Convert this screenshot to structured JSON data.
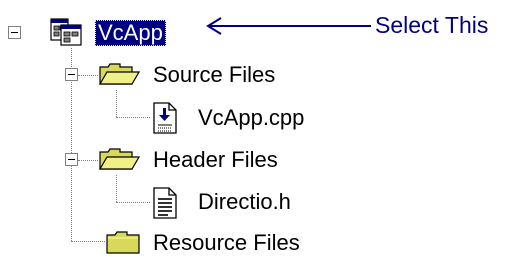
{
  "tree": {
    "root": {
      "label": "VcApp",
      "icon": "workspace-icon",
      "expander": "minus",
      "children": [
        {
          "label": "Source Files",
          "icon": "folder-open-icon",
          "expander": "minus",
          "children": [
            {
              "label": "VcApp.cpp",
              "icon": "source-file-icon"
            }
          ]
        },
        {
          "label": "Header Files",
          "icon": "folder-open-icon",
          "expander": "minus",
          "children": [
            {
              "label": "Directio.h",
              "icon": "header-file-icon"
            }
          ]
        },
        {
          "label": "Resource Files",
          "icon": "folder-closed-icon"
        }
      ]
    }
  },
  "annotation": {
    "text": "Select This",
    "color": "#000080"
  },
  "colors": {
    "selection_background": "#000080",
    "selection_text": "#ffffff",
    "folder_yellow": "#d8d85a"
  }
}
